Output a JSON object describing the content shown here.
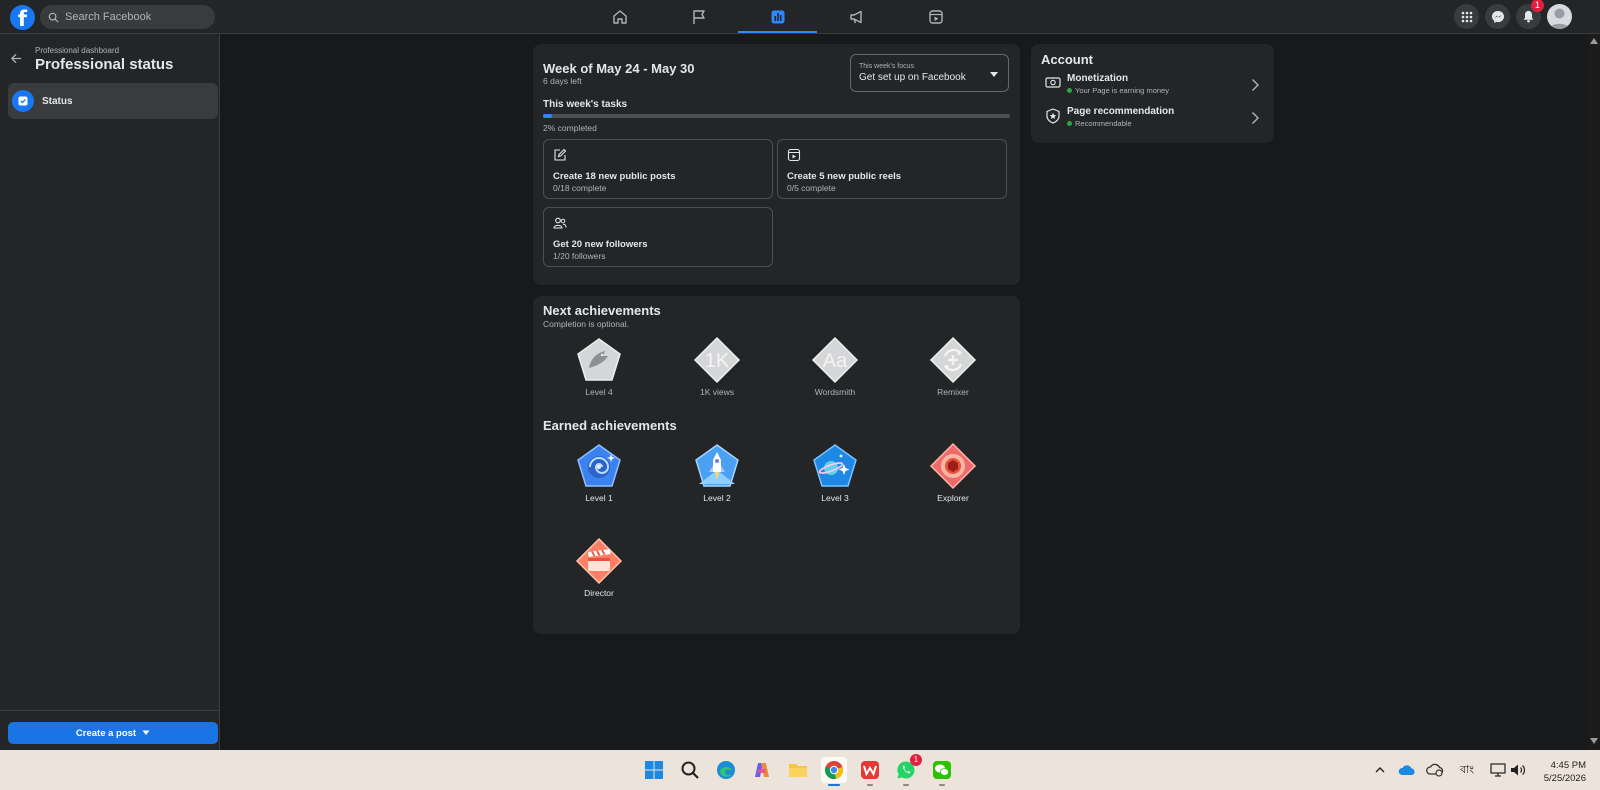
{
  "topbar": {
    "search_placeholder": "Search Facebook",
    "nav_tabs": [
      "home-icon",
      "flag-icon",
      "insights-icon",
      "megaphone-icon",
      "video-icon"
    ],
    "active_tab": "insights-icon",
    "notification_count": "1"
  },
  "sidebar": {
    "breadcrumb": "Professional dashboard",
    "title": "Professional status",
    "item_status": "Status",
    "create_post": "Create a post"
  },
  "week": {
    "title": "Week of May 24 - May 30",
    "days_left": "6 days left",
    "focus_label": "This week's focus",
    "focus_value": "Get set up on Facebook",
    "tasks_heading": "This week's tasks",
    "progress_percent": 2,
    "progress_text": "2% completed",
    "tasks": [
      {
        "title": "Create 18 new public posts",
        "sub": "0/18 complete"
      },
      {
        "title": "Create 5 new public reels",
        "sub": "0/5 complete"
      },
      {
        "title": "Get 20 new followers",
        "sub": "1/20 followers"
      }
    ]
  },
  "achievements": {
    "next_heading": "Next achievements",
    "next_sub": "Completion is optional.",
    "next": [
      {
        "label": "Level 4",
        "glyph": ""
      },
      {
        "label": "1K views",
        "glyph": "1K"
      },
      {
        "label": "Wordsmith",
        "glyph": "Aa"
      },
      {
        "label": "Remixer",
        "glyph": ""
      }
    ],
    "earned_heading": "Earned achievements",
    "earned": [
      {
        "label": "Level 1"
      },
      {
        "label": "Level 2"
      },
      {
        "label": "Level 3"
      },
      {
        "label": "Explorer"
      },
      {
        "label": "Director"
      }
    ]
  },
  "account": {
    "heading": "Account",
    "rows": [
      {
        "title": "Monetization",
        "sub": "Your Page is earning money"
      },
      {
        "title": "Page recommendation",
        "sub": "Recommendable"
      }
    ]
  },
  "taskbar": {
    "whatsapp_badge": "1",
    "lang": "বাং",
    "time": "4:45 PM",
    "date": "5/25/2026"
  }
}
